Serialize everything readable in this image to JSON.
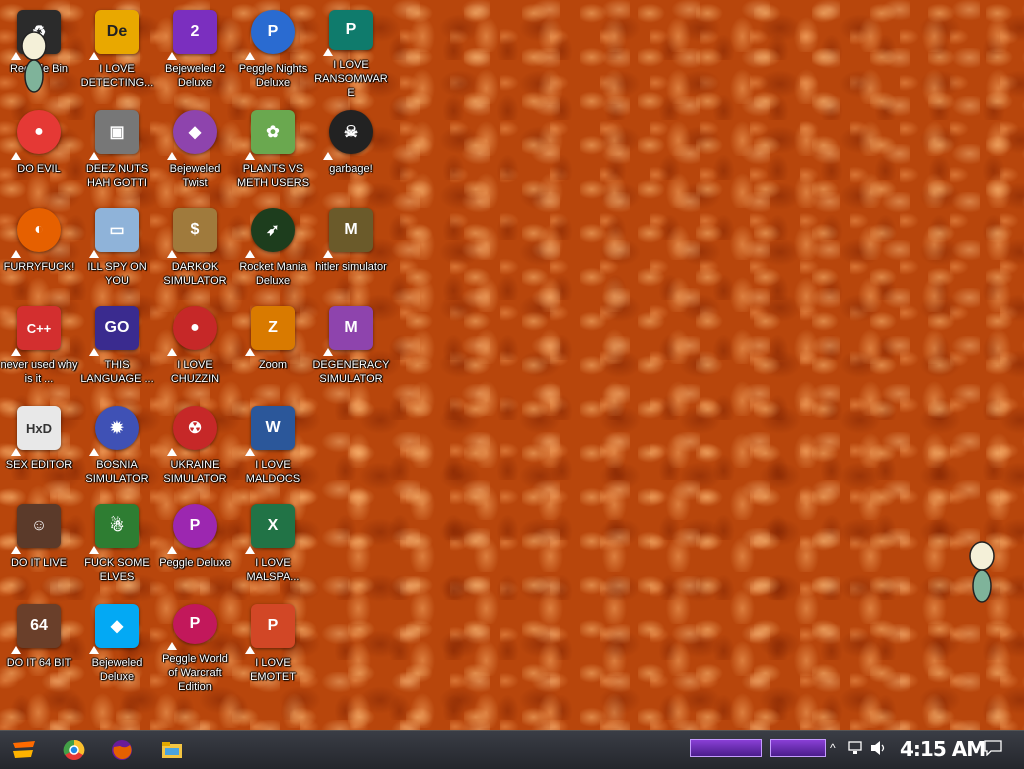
{
  "desktop": {
    "icons": [
      {
        "label": "Recycle Bin",
        "glyph": "♻",
        "color": "#2b2b2b"
      },
      {
        "label": "I LOVE DETECTING...",
        "glyph": "De",
        "color": "#e9a800"
      },
      {
        "label": "Bejeweled 2 Deluxe",
        "glyph": "2",
        "color": "#7b2fbf"
      },
      {
        "label": "Peggle Nights Deluxe",
        "glyph": "P",
        "color": "#2a6bd1"
      },
      {
        "label": "I LOVE RANSOMWARE",
        "glyph": "P",
        "color": "#0f7b6c"
      },
      {
        "label": "DO EVIL",
        "glyph": "●",
        "color": "#e53935"
      },
      {
        "label": "DEEZ NUTS HAH GOTTI",
        "glyph": "▣",
        "color": "#777777"
      },
      {
        "label": "Bejeweled Twist",
        "glyph": "◆",
        "color": "#8e44ad"
      },
      {
        "label": "PLANTS VS METH USERS",
        "glyph": "✿",
        "color": "#6aa84f"
      },
      {
        "label": "garbage!",
        "glyph": "☠",
        "color": "#222222"
      },
      {
        "label": "FURRYFUCK!",
        "glyph": "◐",
        "color": "#e66000"
      },
      {
        "label": "ILL SPY ON YOU",
        "glyph": "▭",
        "color": "#8fb3d9"
      },
      {
        "label": "DARKOK SIMULATOR",
        "glyph": "$",
        "color": "#a07a3c"
      },
      {
        "label": "Rocket Mania Deluxe",
        "glyph": "➶",
        "color": "#1d3d1d"
      },
      {
        "label": "hitler simulator",
        "glyph": "M",
        "color": "#6b5a2a"
      },
      {
        "label": "never used why is it ...",
        "glyph": "C++",
        "color": "#d32f2f"
      },
      {
        "label": "THIS LANGUAGE ...",
        "glyph": "GO",
        "color": "#3a2b8f"
      },
      {
        "label": "I LOVE CHUZZIN",
        "glyph": "●",
        "color": "#c62828"
      },
      {
        "label": "Zoom",
        "glyph": "Z",
        "color": "#d97a00"
      },
      {
        "label": "DEGENERACY SIMULATOR",
        "glyph": "M",
        "color": "#8e44ad"
      },
      {
        "label": "SEX EDITOR",
        "glyph": "HxD",
        "color": "#e8e8e8"
      },
      {
        "label": "BOSNIA SIMULATOR",
        "glyph": "✹",
        "color": "#3f51b5"
      },
      {
        "label": "UKRAINE SIMULATOR",
        "glyph": "☢",
        "color": "#c62828"
      },
      {
        "label": "I LOVE MALDOCS",
        "glyph": "W",
        "color": "#2b579a"
      },
      {
        "label": "DO IT LIVE",
        "glyph": "☺",
        "color": "#5b3a2a"
      },
      {
        "label": "FUCK SOME ELVES",
        "glyph": "☃",
        "color": "#2e7d32"
      },
      {
        "label": "Peggle Deluxe",
        "glyph": "P",
        "color": "#9c27b0"
      },
      {
        "label": "I LOVE MALSPA...",
        "glyph": "X",
        "color": "#217346"
      },
      {
        "label": "DO IT 64 BIT",
        "glyph": "64",
        "color": "#6a3f2a"
      },
      {
        "label": "Bejeweled Deluxe",
        "glyph": "◆",
        "color": "#03a9f4"
      },
      {
        "label": "Peggle World of Warcraft Edition",
        "glyph": "P",
        "color": "#c2185b"
      },
      {
        "label": "I LOVE EMOTET",
        "glyph": "P",
        "color": "#d24726"
      }
    ]
  },
  "taskbar": {
    "start_label": "Start",
    "pinned": [
      {
        "name": "chrome",
        "color": "#e53935"
      },
      {
        "name": "firefox",
        "color": "#e66000"
      },
      {
        "name": "file-explorer",
        "color": "#f4c542"
      }
    ],
    "clock": "4:15 AM",
    "tray_chevron": "^"
  }
}
